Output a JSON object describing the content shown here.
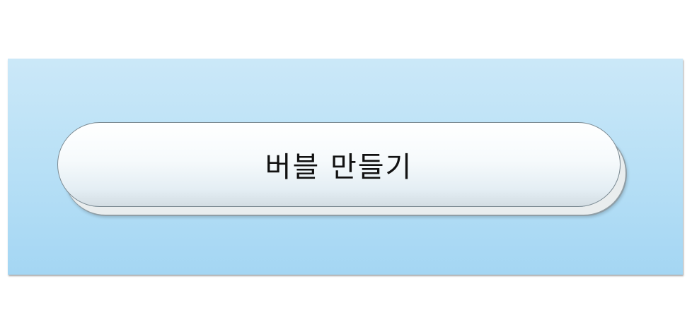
{
  "panel": {
    "background_top": "#cbe8f8",
    "background_bottom": "#a4d6f3"
  },
  "button": {
    "label": "버블 만들기"
  }
}
